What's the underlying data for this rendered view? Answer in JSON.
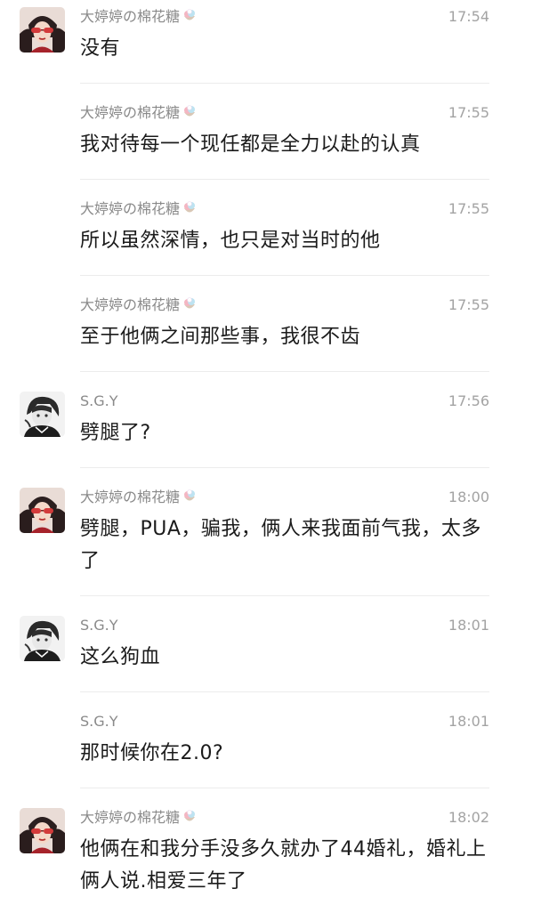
{
  "messages": [
    {
      "name": "大婷婷の棉花糖",
      "time": "17:54",
      "text": "没有",
      "avatar": "girl"
    },
    {
      "name": "大婷婷の棉花糖",
      "time": "17:55",
      "text": "我对待每一个现任都是全力以赴的认真",
      "avatar": "none"
    },
    {
      "name": "大婷婷の棉花糖",
      "time": "17:55",
      "text": "所以虽然深情，也只是对当时的他",
      "avatar": "none"
    },
    {
      "name": "大婷婷の棉花糖",
      "time": "17:55",
      "text": "至于他俩之间那些事，我很不齿",
      "avatar": "none"
    },
    {
      "name": "S.G.Y",
      "time": "17:56",
      "text": "劈腿了?",
      "avatar": "boy"
    },
    {
      "name": "大婷婷の棉花糖",
      "time": "18:00",
      "text": "劈腿，PUA，骗我，俩人来我面前气我，太多了",
      "avatar": "girl"
    },
    {
      "name": "S.G.Y",
      "time": "18:01",
      "text": "这么狗血",
      "avatar": "boy"
    },
    {
      "name": "S.G.Y",
      "time": "18:01",
      "text": "那时候你在2.0?",
      "avatar": "none"
    },
    {
      "name": "大婷婷の棉花糖",
      "time": "18:02",
      "text": "他俩在和我分手没多久就办了44婚礼，婚礼上俩人说.相爱三年了",
      "avatar": "girl"
    }
  ],
  "icons": {
    "name_badge": "ice-cream-icon",
    "avatar_girl": "girl-avatar",
    "avatar_boy": "boy-avatar"
  },
  "colors": {
    "name": "#8a8a8a",
    "time": "#a3a3a3",
    "text": "#1b1b1b",
    "separator": "#ececec"
  }
}
